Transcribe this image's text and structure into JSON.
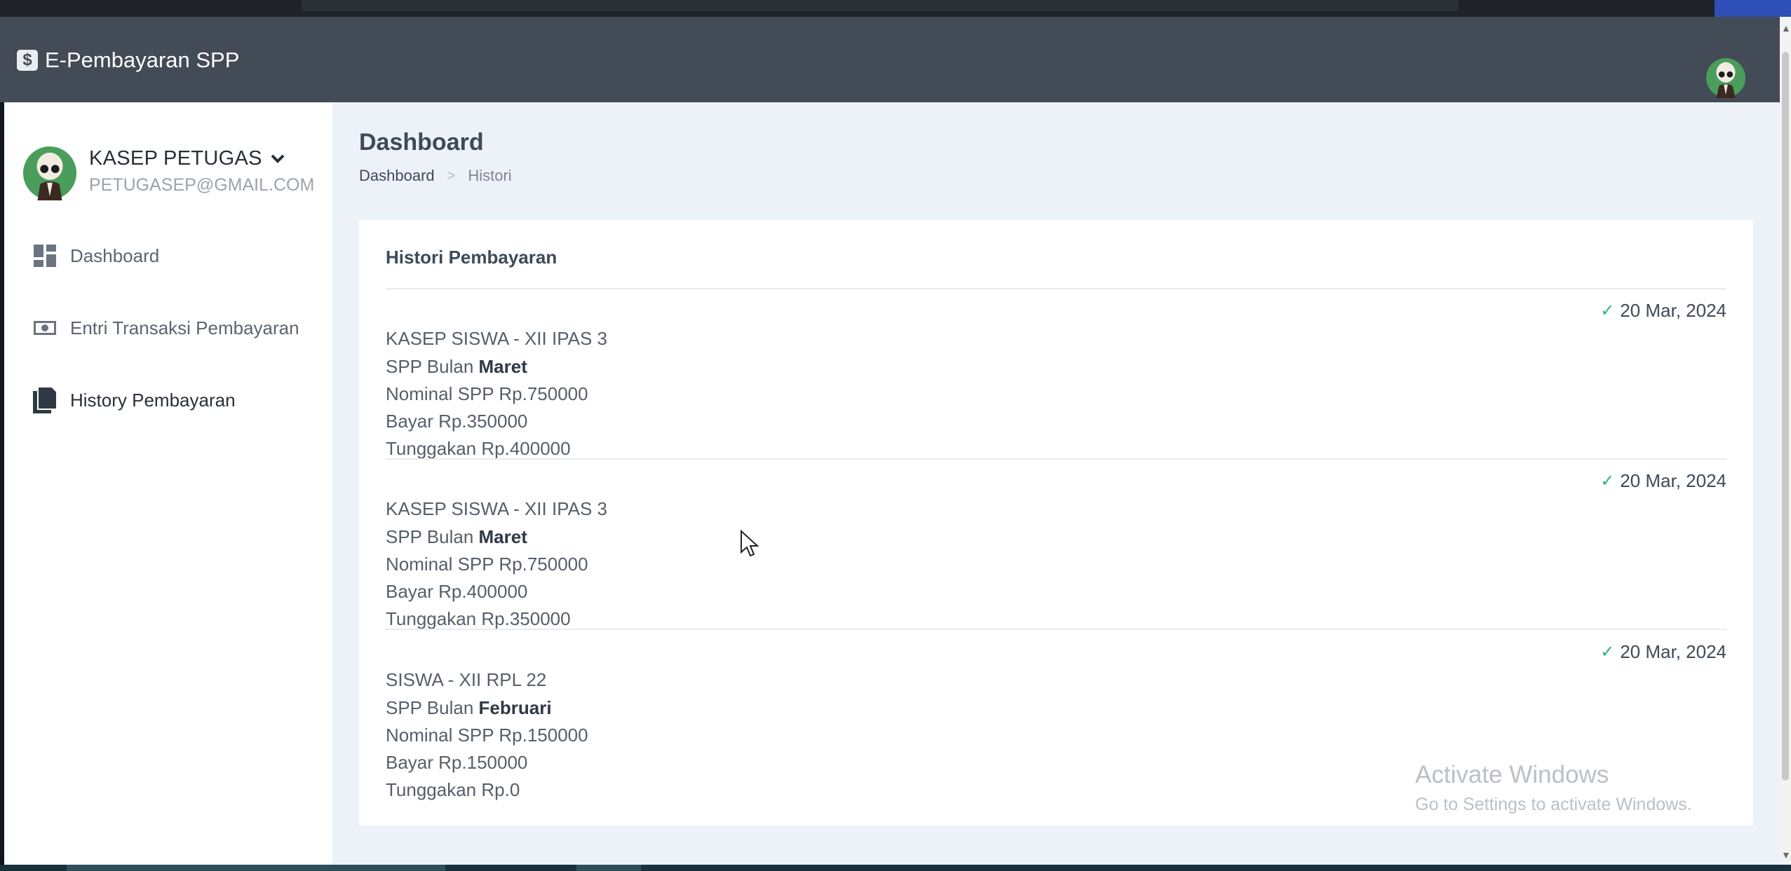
{
  "app": {
    "brand_icon": "$",
    "brand_title": "E-Pembayaran SPP",
    "colors": {
      "navbar": "#434b57",
      "accent_check": "#30b27c",
      "main_bg": "#edf2f8"
    }
  },
  "sidebar": {
    "user": {
      "name": "KASEP PETUGAS",
      "email": "PETUGASEP@GMAIL.COM"
    },
    "items": [
      {
        "label": "Dashboard",
        "icon": "dashboard-icon"
      },
      {
        "label": "Entri Transaksi Pembayaran",
        "icon": "money-icon"
      },
      {
        "label": "History Pembayaran",
        "icon": "file-icon",
        "active": true
      }
    ]
  },
  "page": {
    "title": "Dashboard",
    "breadcrumb": {
      "home": "Dashboard",
      "current": "Histori"
    }
  },
  "card": {
    "title": "Histori Pembayaran",
    "entries": [
      {
        "date": "20 Mar, 2024",
        "student": "KASEP SISWA - XII IPAS 3",
        "month_prefix": "SPP Bulan",
        "month": "Maret",
        "nominal": "Nominal SPP Rp.750000",
        "paid": "Bayar Rp.350000",
        "arrears": "Tunggakan Rp.400000"
      },
      {
        "date": "20 Mar, 2024",
        "student": "KASEP SISWA - XII IPAS 3",
        "month_prefix": "SPP Bulan",
        "month": "Maret",
        "nominal": "Nominal SPP Rp.750000",
        "paid": "Bayar Rp.400000",
        "arrears": "Tunggakan Rp.350000"
      },
      {
        "date": "20 Mar, 2024",
        "student": "SISWA - XII RPL 22",
        "month_prefix": "SPP Bulan",
        "month": "Februari",
        "nominal": "Nominal SPP Rp.150000",
        "paid": "Bayar Rp.150000",
        "arrears": "Tunggakan Rp.0"
      }
    ]
  },
  "watermark": {
    "title": "Activate Windows",
    "subtitle": "Go to Settings to activate Windows."
  }
}
